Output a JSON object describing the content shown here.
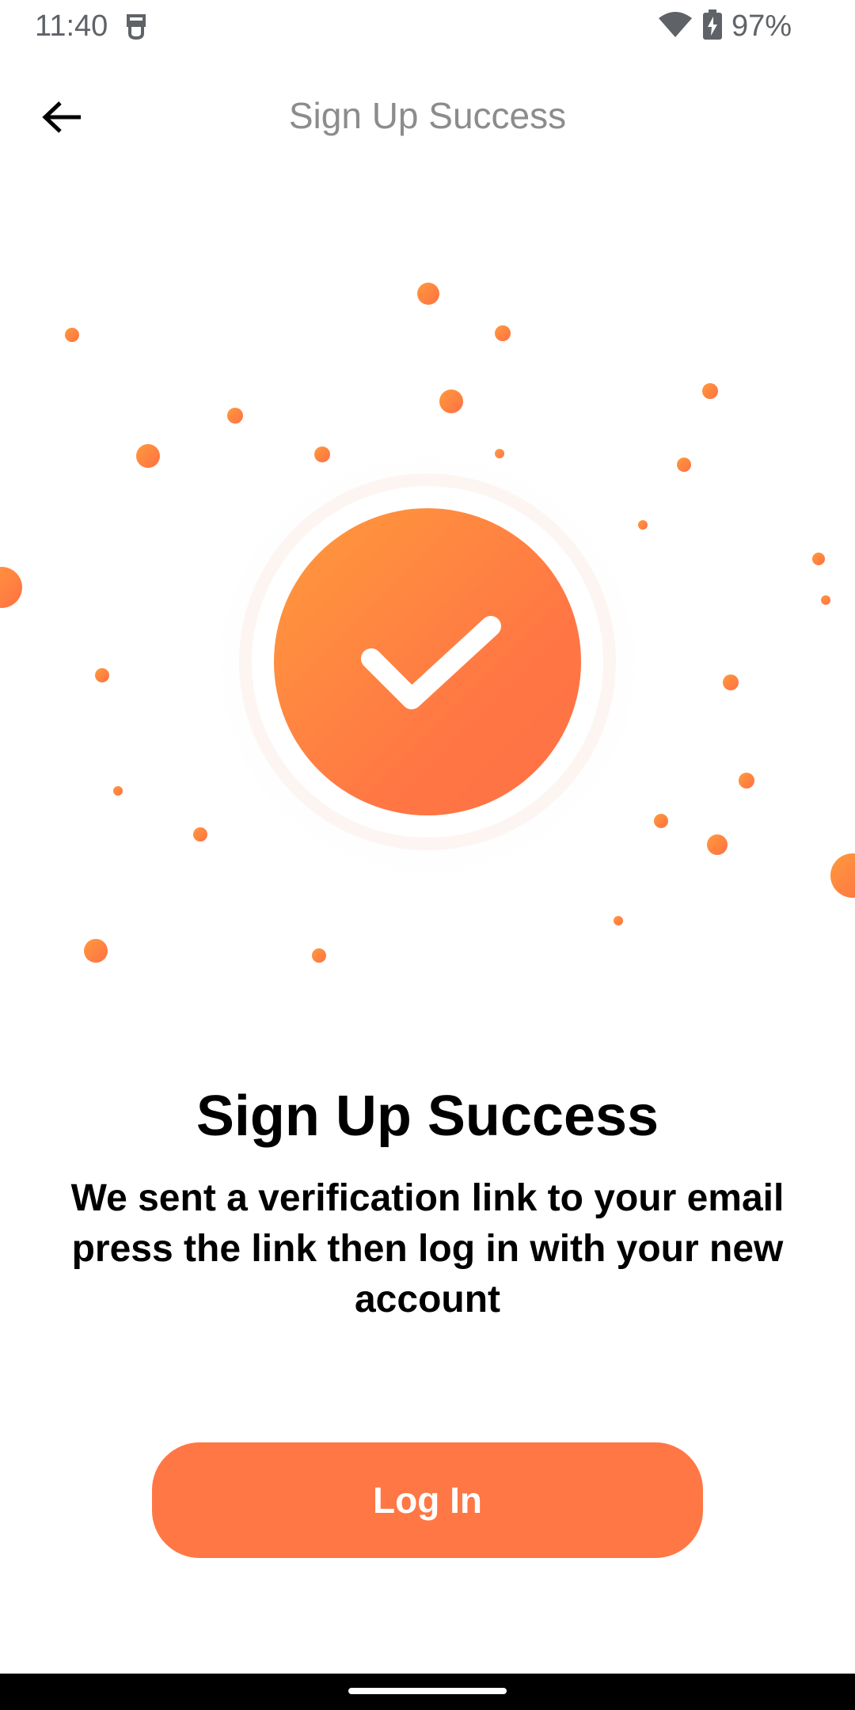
{
  "status_bar": {
    "time": "11:40",
    "battery_percent": "97%",
    "icons": [
      "notification-icon",
      "wifi-icon",
      "battery-charging-icon"
    ]
  },
  "app_bar": {
    "title": "Sign Up Success",
    "back_icon": "arrow-left-icon"
  },
  "illustration": {
    "icon": "check-icon",
    "accent_color": "#ff7744",
    "gradient_start": "#ff9a3c",
    "gradient_end": "#ff7044"
  },
  "content": {
    "heading": "Sign Up Success",
    "message": "We sent a verification link to your email press the link then log in with your new account"
  },
  "actions": {
    "login_label": "Log In"
  },
  "colors": {
    "accent": "#ff7744",
    "title_gray": "#8c8c8c",
    "status_gray": "#5f6368"
  }
}
